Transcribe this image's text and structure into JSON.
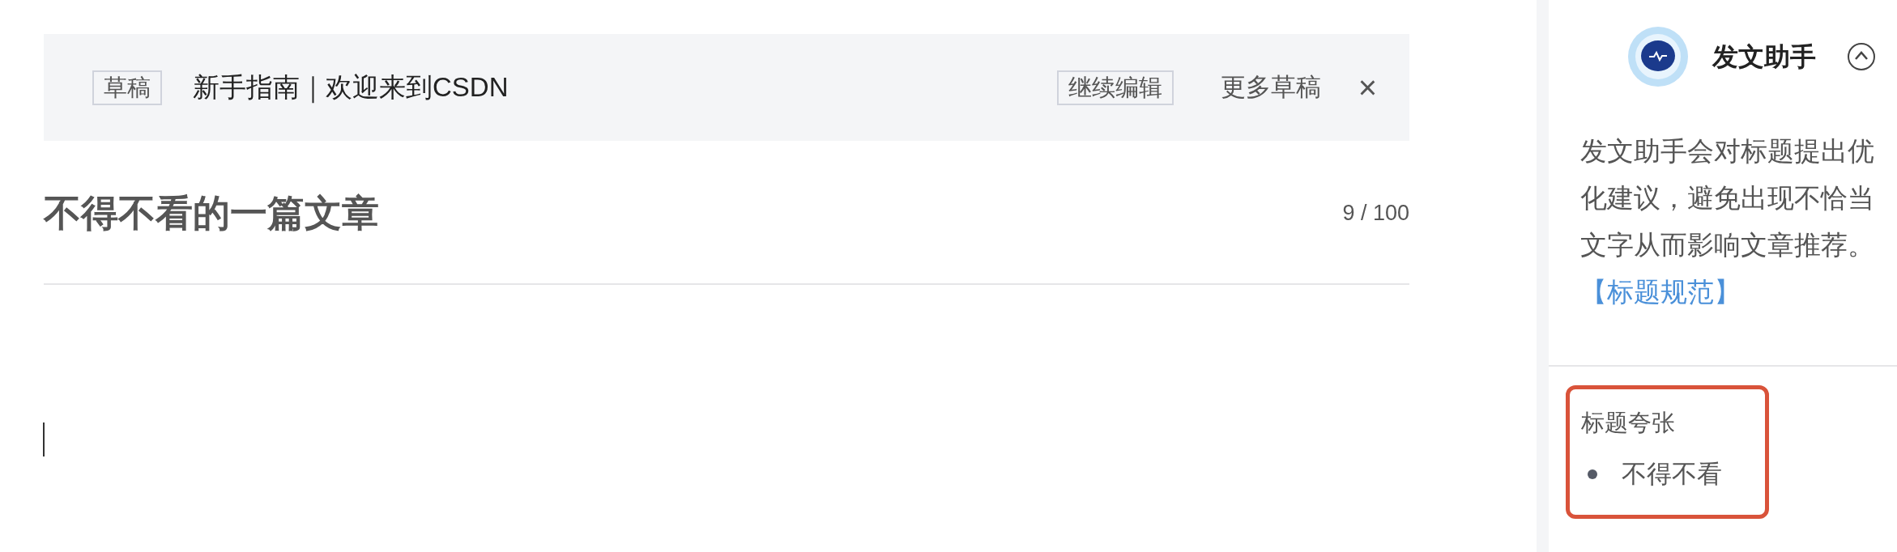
{
  "draft_bar": {
    "tag": "草稿",
    "title": "新手指南｜欢迎来到CSDN",
    "continue_button": "继续编辑",
    "more_drafts": "更多草稿",
    "close": "×"
  },
  "editor": {
    "title": "不得不看的一篇文章",
    "counter": "9 / 100"
  },
  "assistant": {
    "name": "发文助手",
    "expanded": true,
    "description": "发文助手会对标题提出优化建议，避免出现不恰当文字从而影响文章推荐。",
    "link": "【标题规范】",
    "issue": {
      "category": "标题夸张",
      "items": [
        "不得不看"
      ]
    }
  }
}
